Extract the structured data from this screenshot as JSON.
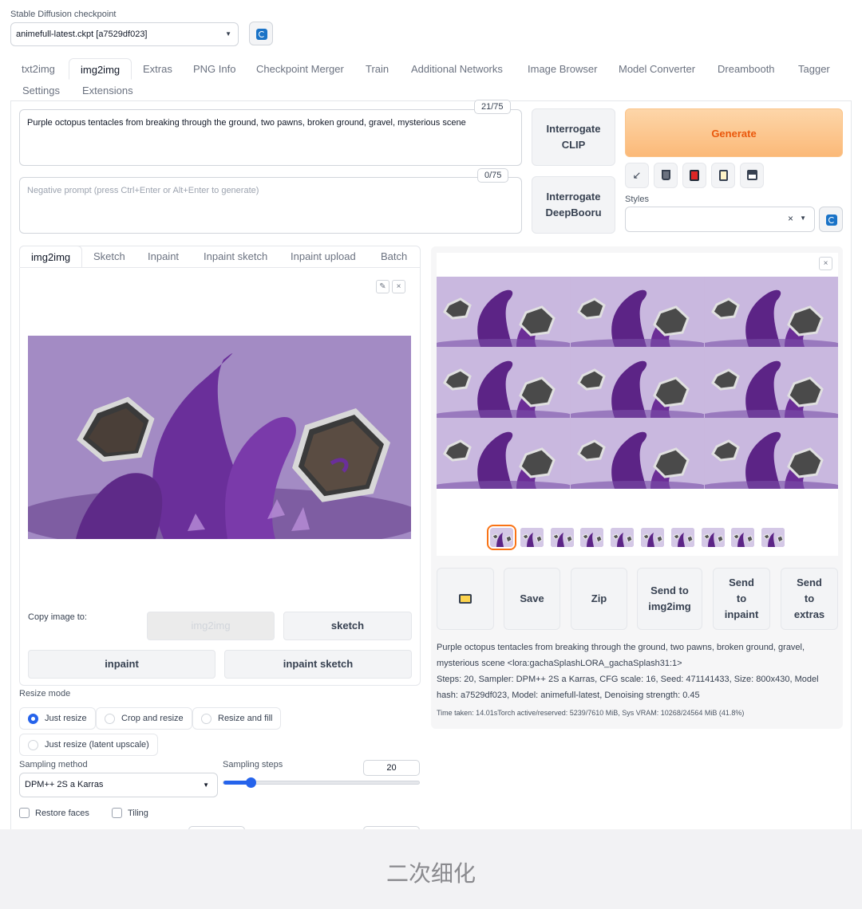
{
  "checkpoint": {
    "label": "Stable Diffusion checkpoint",
    "value": "animefull-latest.ckpt [a7529df023]"
  },
  "main_tabs": [
    "txt2img",
    "img2img",
    "Extras",
    "PNG Info",
    "Checkpoint Merger",
    "Train",
    "Additional Networks",
    "Image Browser",
    "Model Converter",
    "Dreambooth",
    "Tagger",
    "Settings",
    "Extensions"
  ],
  "prompt": {
    "text": "Purple octopus tentacles from breaking through the ground, two pawns, broken ground, gravel, mysterious scene",
    "counter": "21/75",
    "negative_placeholder": "Negative prompt (press Ctrl+Enter or Alt+Enter to generate)",
    "negative_counter": "0/75"
  },
  "buttons": {
    "interrogate_clip": "Interrogate CLIP",
    "interrogate_deepbooru": "Interrogate DeepBooru",
    "generate": "Generate"
  },
  "tool_icons": [
    "arrow-icon",
    "trash-icon",
    "model-icon",
    "clipboard-icon",
    "save-icon"
  ],
  "styles": {
    "label": "Styles",
    "clear": "×"
  },
  "sub_tabs": [
    "img2img",
    "Sketch",
    "Inpaint",
    "Inpaint sketch",
    "Inpaint upload",
    "Batch"
  ],
  "copy": {
    "label": "Copy image to:",
    "img2img": "img2img",
    "sketch": "sketch",
    "inpaint": "inpaint",
    "inpaint_sketch": "inpaint sketch"
  },
  "resize": {
    "label": "Resize mode",
    "options": [
      "Just resize",
      "Crop and resize",
      "Resize and fill",
      "Just resize (latent upscale)"
    ],
    "selected": "Just resize"
  },
  "sampling": {
    "method_label": "Sampling method",
    "method_value": "DPM++ 2S a Karras",
    "steps_label": "Sampling steps",
    "steps_value": "20",
    "steps_fraction": 0.14
  },
  "checkboxes": {
    "restore_faces": "Restore faces",
    "tiling": "Tiling"
  },
  "gallery": {
    "close": "×",
    "thumb_count": 10,
    "selected_index": 0
  },
  "actions": {
    "save": "Save",
    "zip": "Zip",
    "send_img2img": "Send to img2img",
    "send_inpaint": "Send to inpaint",
    "send_extras": "Send to extras"
  },
  "info": {
    "line1": "Purple octopus tentacles from breaking through the ground, two pawns, broken ground, gravel, mysterious scene <lora:gachaSplashLORA_gachaSplash31:1>",
    "line2": "Steps: 20, Sampler: DPM++ 2S a Karras, CFG scale: 16, Seed: 471141433, Size: 800x430, Model hash: a7529df023, Model: animefull-latest, Denoising strength: 0.45",
    "time": "Time taken: 14.01sTorch active/reserved: 5239/7610 MiB, Sys VRAM: 10268/24564 MiB (41.8%)"
  },
  "caption": "二次细化",
  "colors": {
    "accent": "#2563eb",
    "generate": "#fbb978",
    "generate_text": "#ea580c",
    "selection": "#f97316"
  }
}
